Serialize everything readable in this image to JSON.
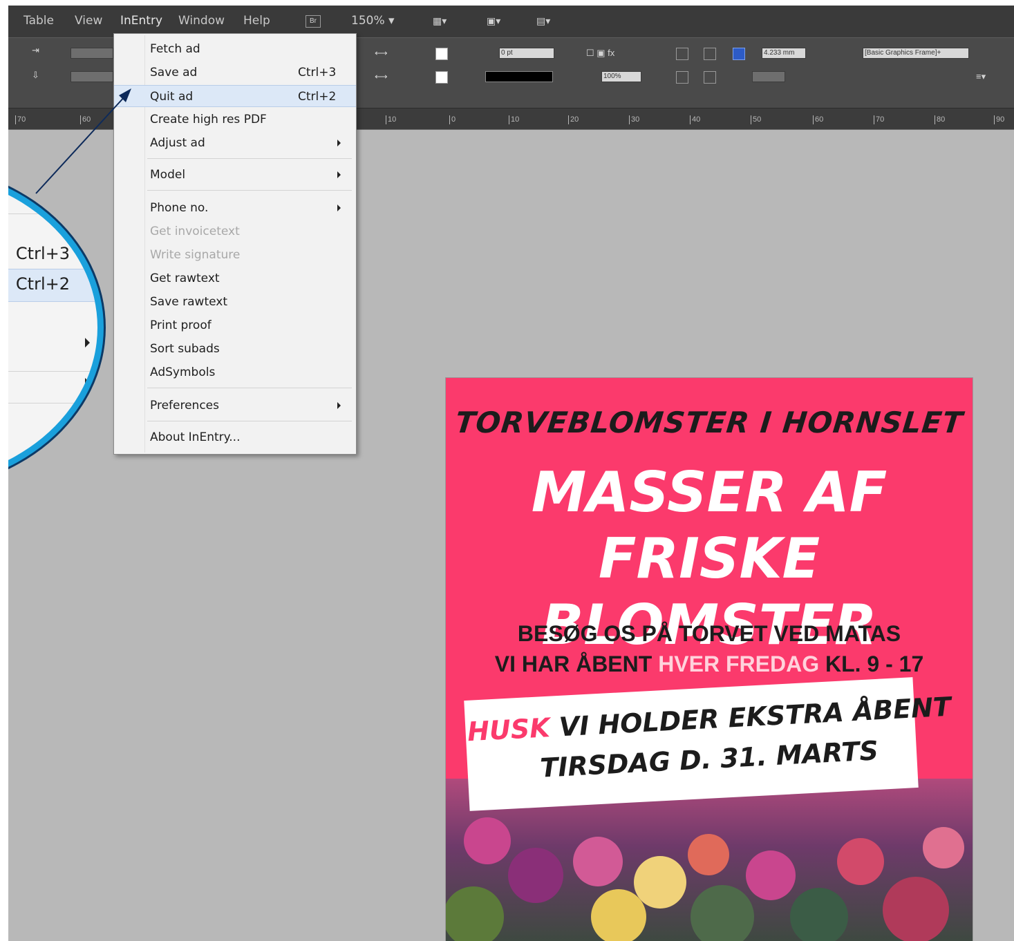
{
  "menubar": {
    "items": [
      "Table",
      "View",
      "InEntry",
      "Window",
      "Help"
    ],
    "br_label": "Br",
    "zoom": "150%"
  },
  "control_panel": {
    "stroke_weight": "0 pt",
    "percent": "100%",
    "gap_size": "4.233 mm",
    "object_style": "[Basic Graphics Frame]+"
  },
  "ruler": {
    "ticks": [
      "70",
      "60",
      "10",
      "0",
      "10",
      "20",
      "30",
      "40",
      "50",
      "60",
      "70",
      "80",
      "90"
    ]
  },
  "inentry_menu": {
    "items": [
      {
        "label": "Fetch ad",
        "shortcut": ""
      },
      {
        "label": "Save ad",
        "shortcut": "Ctrl+3"
      },
      {
        "label": "Quit ad",
        "shortcut": "Ctrl+2"
      },
      {
        "label": "Create high res PDF",
        "shortcut": ""
      },
      {
        "label": "Adjust ad",
        "shortcut": ""
      },
      {
        "label": "Model",
        "shortcut": ""
      },
      {
        "label": "Phone no.",
        "shortcut": ""
      },
      {
        "label": "Get invoicetext",
        "shortcut": ""
      },
      {
        "label": "Write signature",
        "shortcut": ""
      },
      {
        "label": "Get rawtext",
        "shortcut": ""
      },
      {
        "label": "Save rawtext",
        "shortcut": ""
      },
      {
        "label": "Print proof",
        "shortcut": ""
      },
      {
        "label": "Sort subads",
        "shortcut": ""
      },
      {
        "label": "AdSymbols",
        "shortcut": ""
      },
      {
        "label": "Preferences",
        "shortcut": ""
      },
      {
        "label": "About InEntry..."
      }
    ],
    "highlighted": "Quit ad"
  },
  "zoom_callout": {
    "shortcut_save": "Ctrl+3",
    "shortcut_quit": "Ctrl+2"
  },
  "ad": {
    "title": "TORVEBLOMSTER I HORNSLET",
    "headline_1": "MASSER AF",
    "headline_2": "FRISKE BLOMSTER",
    "info_1": "BESØG OS PÅ TORVET VED MATAS",
    "info_2a": "VI HAR ÅBENT ",
    "info_2b": "HVER FREDAG",
    "info_2c": " KL. 9 - 17",
    "banner_husk": "HUSK",
    "banner_1": " VI HOLDER EKSTRA ÅBENT",
    "banner_2": "TIRSDAG D. 31. MARTS"
  },
  "colors": {
    "ad_pink": "#fb3a6c",
    "callout_blue": "#1aa0dc",
    "arrow_navy": "#0d2a5a"
  }
}
